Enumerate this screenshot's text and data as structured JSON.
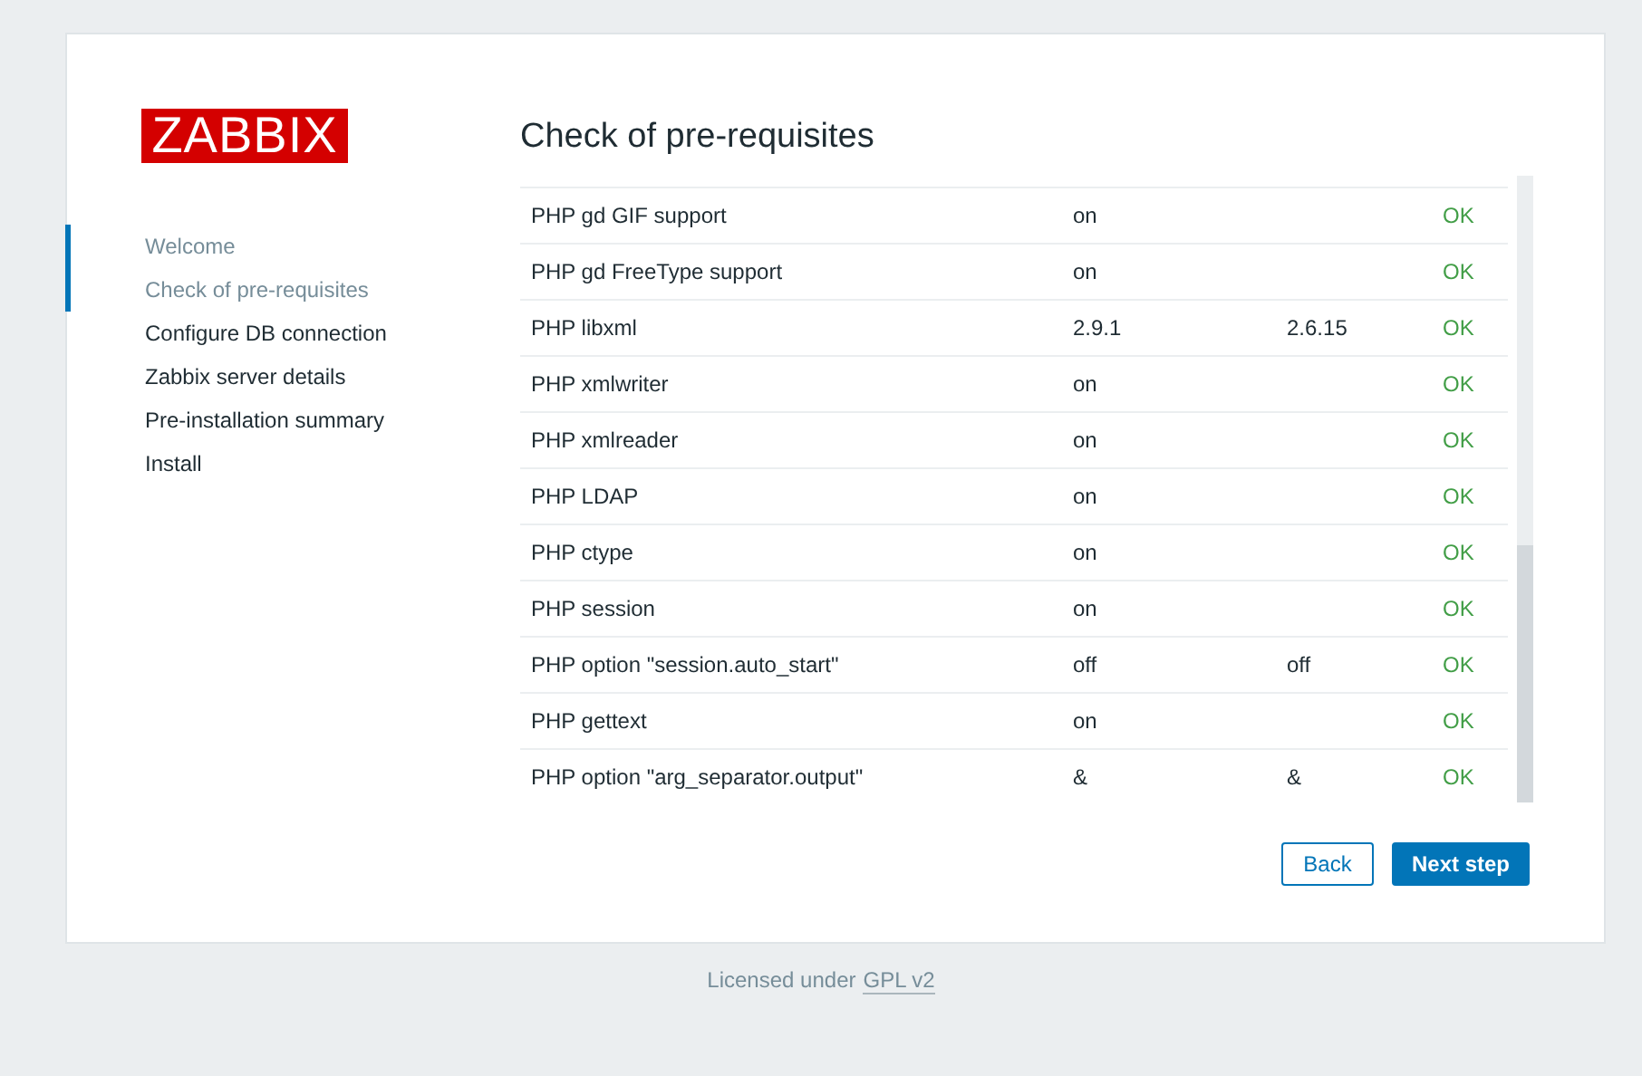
{
  "logo": "ZABBIX",
  "steps": [
    {
      "label": "Welcome",
      "done": true
    },
    {
      "label": "Check of pre-requisites",
      "done": true
    },
    {
      "label": "Configure DB connection",
      "done": false
    },
    {
      "label": "Zabbix server details",
      "done": false
    },
    {
      "label": "Pre-installation summary",
      "done": false
    },
    {
      "label": "Install",
      "done": false
    }
  ],
  "title": "Check of pre-requisites",
  "rows": [
    {
      "name": "PHP gd GIF support",
      "current": "on",
      "required": "",
      "result": "OK"
    },
    {
      "name": "PHP gd FreeType support",
      "current": "on",
      "required": "",
      "result": "OK"
    },
    {
      "name": "PHP libxml",
      "current": "2.9.1",
      "required": "2.6.15",
      "result": "OK"
    },
    {
      "name": "PHP xmlwriter",
      "current": "on",
      "required": "",
      "result": "OK"
    },
    {
      "name": "PHP xmlreader",
      "current": "on",
      "required": "",
      "result": "OK"
    },
    {
      "name": "PHP LDAP",
      "current": "on",
      "required": "",
      "result": "OK"
    },
    {
      "name": "PHP ctype",
      "current": "on",
      "required": "",
      "result": "OK"
    },
    {
      "name": "PHP session",
      "current": "on",
      "required": "",
      "result": "OK"
    },
    {
      "name": "PHP option \"session.auto_start\"",
      "current": "off",
      "required": "off",
      "result": "OK"
    },
    {
      "name": "PHP gettext",
      "current": "on",
      "required": "",
      "result": "OK"
    },
    {
      "name": "PHP option \"arg_separator.output\"",
      "current": "&",
      "required": "&",
      "result": "OK"
    }
  ],
  "buttons": [
    {
      "label": "Back",
      "kind": "secondary"
    },
    {
      "label": "Next step",
      "kind": "primary"
    }
  ],
  "footer": {
    "text": "Licensed under",
    "link": "GPL v2"
  }
}
